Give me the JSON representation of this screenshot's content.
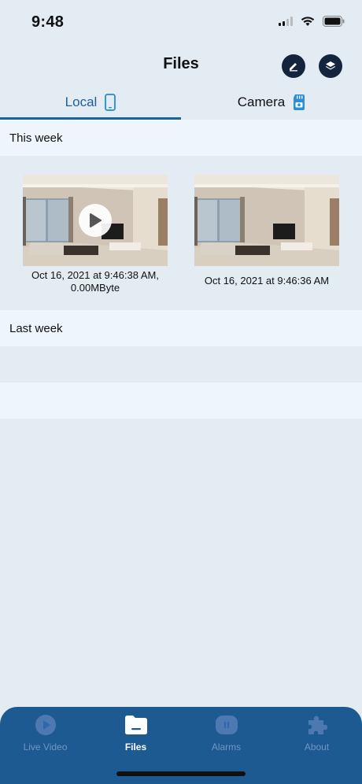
{
  "status_bar": {
    "time": "9:48",
    "icons": [
      "cellular-signal-icon",
      "wifi-icon",
      "battery-icon"
    ]
  },
  "header": {
    "title": "Files",
    "actions": [
      "edit-icon",
      "layers-icon"
    ]
  },
  "tabs": [
    {
      "label": "Local",
      "icon": "phone-icon",
      "selected": true
    },
    {
      "label": "Camera",
      "icon": "sd-card-camera-icon",
      "selected": false
    }
  ],
  "sections": [
    {
      "title": "This week",
      "items": [
        {
          "caption": "Oct 16, 2021 at 9:46:38 AM, 0.00MByte",
          "type": "video"
        },
        {
          "caption": "Oct 16, 2021 at 9:46:36 AM",
          "type": "photo"
        }
      ]
    },
    {
      "title": "Last week",
      "items": []
    }
  ],
  "tabbar": {
    "items": [
      {
        "label": "Live Video",
        "icon": "live-video-icon",
        "active": false
      },
      {
        "label": "Files",
        "icon": "folder-icon",
        "active": true
      },
      {
        "label": "Alarms",
        "icon": "alarm-icon",
        "active": false
      },
      {
        "label": "About",
        "icon": "puzzle-icon",
        "active": false
      }
    ]
  },
  "colors": {
    "background": "#e3ebf3",
    "section_background": "#eef5fc",
    "accent": "#1f5f9a",
    "tabbar_background": "#1e5a92",
    "header_button": "#14243d"
  }
}
